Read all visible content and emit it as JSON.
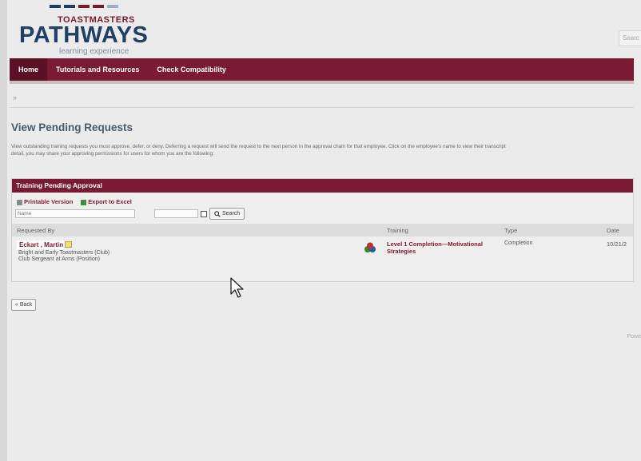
{
  "brand": {
    "org": "TOASTMASTERS",
    "name": "PATHWAYS",
    "tagline": "learning experience",
    "colors": {
      "maroon": "#7b1a33",
      "navy": "#1f3f66"
    }
  },
  "header": {
    "search_placeholder": "Searc"
  },
  "nav": {
    "items": [
      {
        "label": "Home"
      },
      {
        "label": "Tutorials and Resources"
      },
      {
        "label": "Check Compatibility"
      }
    ]
  },
  "breadcrumb": "»",
  "page": {
    "title": "View Pending Requests",
    "description_line1": "View outstanding training requests you must approve, defer, or deny. Deferring a request will send the request to the next person in the approval chain for that employee. Click on the employee's name to view their transcript",
    "description_line2": "detail, you may share your approving permissions for users for whom you are the following:"
  },
  "panel": {
    "title": "Training Pending Approval",
    "printable": "Printable Version",
    "export": "Export to Excel",
    "name_placeholder": "Name",
    "search_label": "Search",
    "columns": {
      "requested_by": "Requested By",
      "training": "Training",
      "type": "Type",
      "date": "Date"
    },
    "rows": [
      {
        "name": "Eckart , Martin",
        "club": "Bright and Early Toastmasters (Club)",
        "position": "Club Sergeant at Arms (Position)",
        "training_line1": "Level 1 Completion—Motivational",
        "training_line2": "Strategies",
        "type": "Completion",
        "date": "10/21/2"
      }
    ]
  },
  "back_label": "« Back",
  "footer": "Powe"
}
